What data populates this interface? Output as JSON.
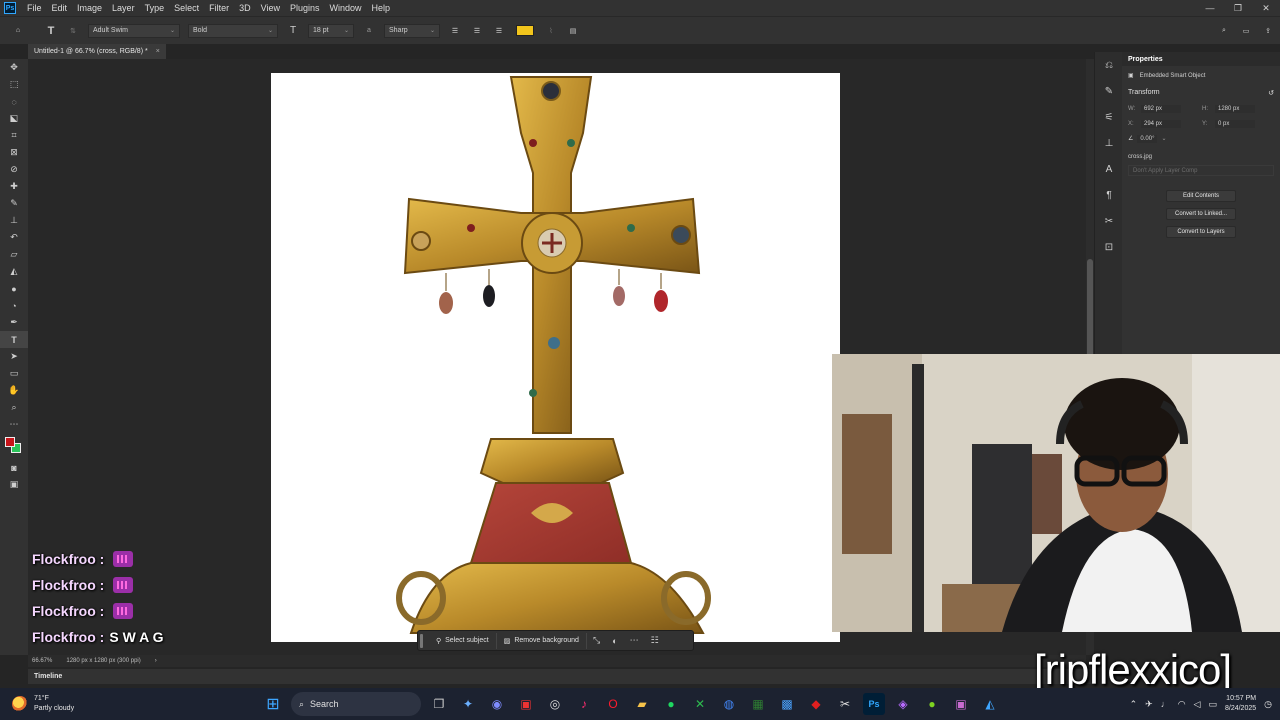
{
  "menubar": {
    "app_logo": "Ps",
    "items": [
      "File",
      "Edit",
      "Image",
      "Layer",
      "Type",
      "Select",
      "Filter",
      "3D",
      "View",
      "Plugins",
      "Window",
      "Help"
    ],
    "window_controls": [
      "—",
      "❐",
      "✕"
    ]
  },
  "options": {
    "font_family": "Adult Swim",
    "font_style": "Bold",
    "font_size": "18 pt",
    "antialias": "Sharp",
    "text_color": "#f2c51c"
  },
  "document": {
    "tab_title": "Untitled-1 @ 66.7% (cross, RGB/8) *",
    "zoom": "66.67%",
    "doc_info": "1280 px x 1280 px (300 ppi)"
  },
  "context_bar": {
    "select_subject": "Select subject",
    "remove_background": "Remove background"
  },
  "panels": {
    "timeline_label": "Timeline",
    "properties": {
      "tab": "Properties",
      "object_type": "Embedded Smart Object",
      "section": "Transform",
      "w_label": "W:",
      "w_value": "692 px",
      "h_label": "H:",
      "h_value": "1280 px",
      "x_label": "X:",
      "x_value": "294 px",
      "y_label": "Y:",
      "y_value": "0 px",
      "angle": "0.00°",
      "filename": "cross.jpg",
      "layer_comp": "Don't Apply Layer Comp",
      "btn_edit": "Edit Contents",
      "btn_convert_linked": "Convert to Linked...",
      "btn_convert_layers": "Convert to Layers"
    }
  },
  "chat": [
    {
      "user": "Flockfroo :",
      "msg": "",
      "emote": true
    },
    {
      "user": "Flockfroo :",
      "msg": "",
      "emote": true
    },
    {
      "user": "Flockfroo :",
      "msg": "",
      "emote": true
    },
    {
      "user": "Flockfroo :",
      "msg": "S W A G",
      "emote": false
    }
  ],
  "overlay": {
    "streamer_name": "[ripflexxico]"
  },
  "taskbar": {
    "temperature": "71°F",
    "weather": "Partly cloudy",
    "search": "Search",
    "time": "10:57 PM",
    "date": "8/24/2025"
  }
}
